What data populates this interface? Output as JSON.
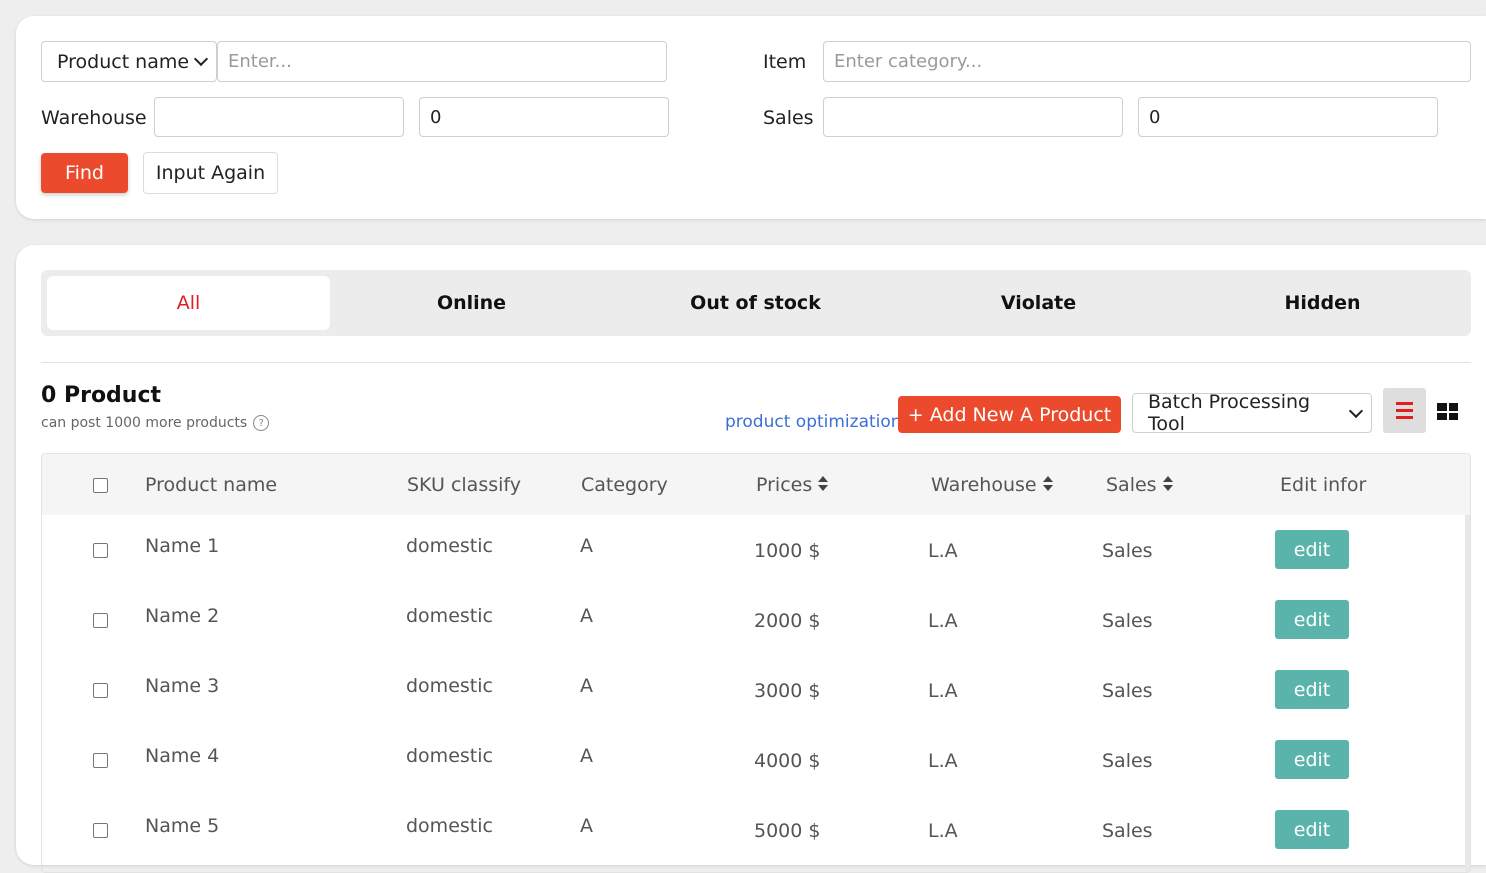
{
  "filter": {
    "search_type": "Product name",
    "search_placeholder": "Enter...",
    "item_label": "Item",
    "item_placeholder": "Enter category...",
    "warehouse_label": "Warehouse",
    "warehouse_min": "",
    "warehouse_max": "0",
    "sales_label": "Sales",
    "sales_min": "",
    "sales_max": "0",
    "find_label": "Find",
    "reset_label": "Input Again"
  },
  "tabs": [
    {
      "label": "All",
      "active": true
    },
    {
      "label": "Online",
      "active": false
    },
    {
      "label": "Out of stock",
      "active": false
    },
    {
      "label": "Violate",
      "active": false
    },
    {
      "label": "Hidden",
      "active": false
    }
  ],
  "summary": {
    "count_title": "0 Product",
    "count_sub": "can post 1000 more products",
    "help_icon": "?",
    "optimization_link": "product optimization",
    "add_button": "+ Add New A Product",
    "batch_tool": "Batch Processing Tool"
  },
  "table": {
    "headers": [
      "Product name",
      "SKU classify",
      "Category",
      "Prices",
      "Warehouse",
      "Sales",
      "Edit infor"
    ],
    "rows": [
      {
        "name": "Name 1",
        "sku": "domestic",
        "category": "A",
        "price": "1000 $",
        "warehouse": "L.A",
        "sales": "Sales",
        "edit": "edit"
      },
      {
        "name": "Name 2",
        "sku": "domestic",
        "category": "A",
        "price": "2000 $",
        "warehouse": "L.A",
        "sales": "Sales",
        "edit": "edit"
      },
      {
        "name": "Name 3",
        "sku": "domestic",
        "category": "A",
        "price": "3000 $",
        "warehouse": "L.A",
        "sales": "Sales",
        "edit": "edit"
      },
      {
        "name": "Name 4",
        "sku": "domestic",
        "category": "A",
        "price": "4000 $",
        "warehouse": "L.A",
        "sales": "Sales",
        "edit": "edit"
      },
      {
        "name": "Name 5",
        "sku": "domestic",
        "category": "A",
        "price": "5000 $",
        "warehouse": "L.A",
        "sales": "Sales",
        "edit": "edit"
      }
    ]
  },
  "colors": {
    "accent": "#ec4a2c",
    "edit_button": "#5bb4ac",
    "active_tab_text": "#e02020",
    "link": "#3c6fd8"
  }
}
